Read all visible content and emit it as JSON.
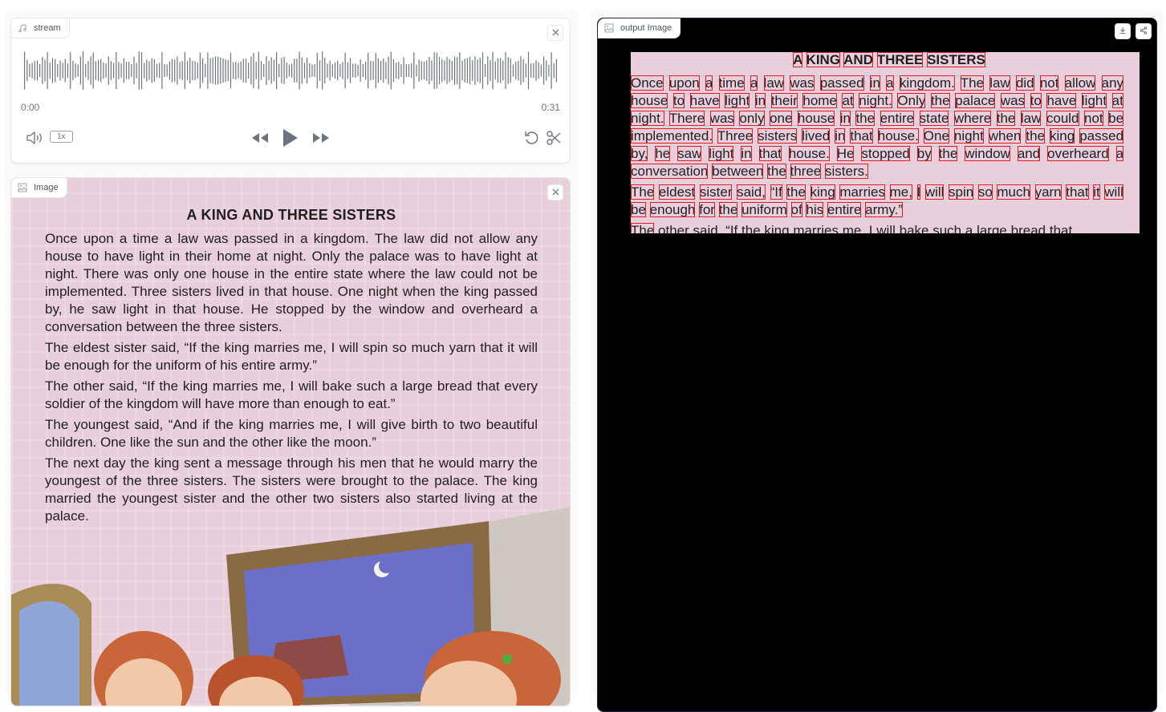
{
  "audio": {
    "label": "stream",
    "time_start": "0:00",
    "time_end": "0:31",
    "speed": "1x"
  },
  "image": {
    "label": "Image"
  },
  "output": {
    "label": "output Image"
  },
  "story": {
    "title": "A KING AND THREE SISTERS",
    "paragraphs": [
      "Once upon a time a law was passed in a kingdom. The law did not allow any house to have light in their home at night. Only the palace was to have light at night. There was only one house in the entire state where the law could not be implemented. Three sisters lived in that house. One night when the king passed by, he saw light in that house. He stopped by the window and overheard a conversation between the three sisters.",
      "The eldest sister said, “If the king marries me, I will spin so much yarn that it will be enough for the uniform of his entire army.”",
      "The other said, “If the king marries me, I will bake such a large bread that every soldier of the kingdom will have more than enough to eat.”",
      "The youngest said, “And if the king marries me, I will give birth to two beautiful children. One like the sun and the other like the moon.”",
      "The next day the king sent a message through his men that he would marry the youngest of the three sisters. The sisters were brought to the palace. The king married the youngest sister and the other two sisters also started living at the palace."
    ]
  },
  "output_text": {
    "title": "A KING AND THREE SISTERS",
    "paragraphs": [
      "Once upon a time a law was passed in a kingdom. The law did not allow any house to have light in their home at night. Only the palace was to have light at night. There was only one house in the entire state where the law could not be implemented. Three sisters lived in that house. One night when the king passed by, he saw light in that house. He stopped by the window and overheard a conversation between the three sisters.",
      "The eldest sister said, “If the king marries me, I will spin so much yarn that it will be enough for the uniform of his entire army.”",
      "The other said, “If the king marries me, I will bake such a large bread that"
    ],
    "box_color": "#e01b24"
  }
}
